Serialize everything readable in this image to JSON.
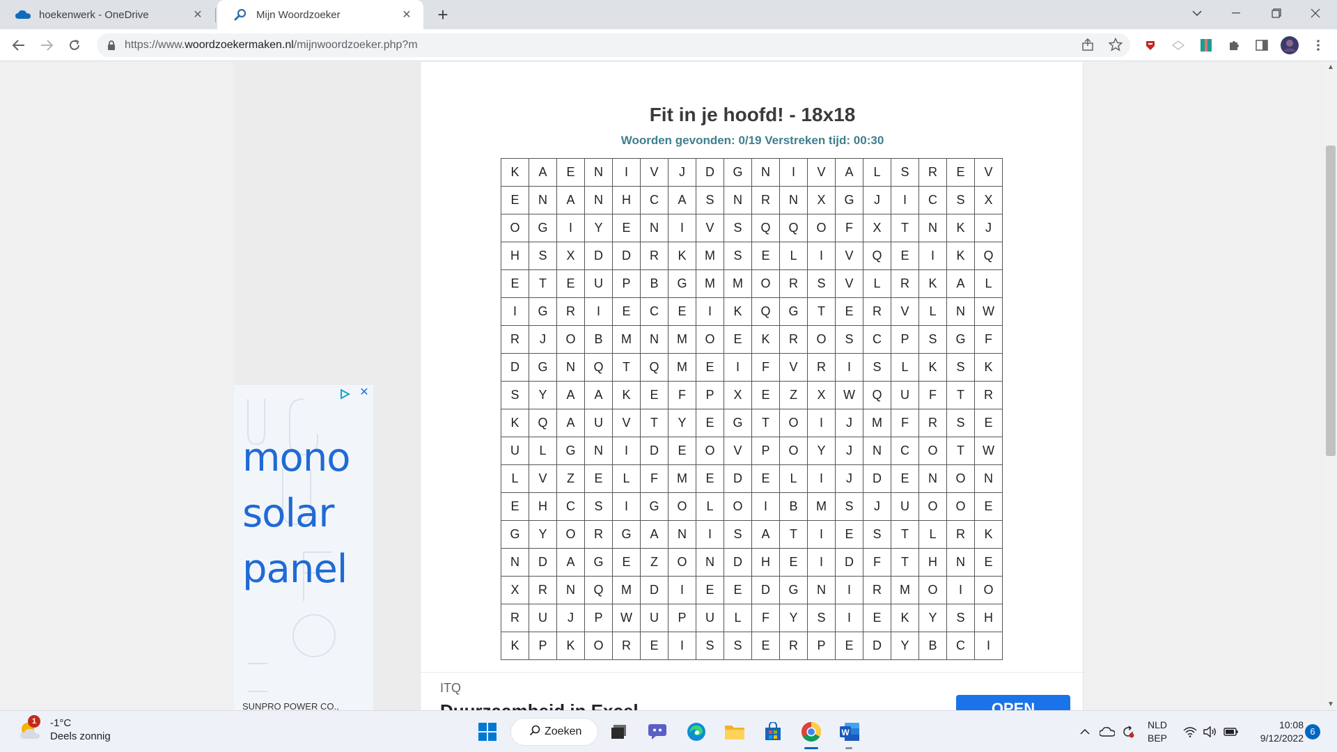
{
  "browser": {
    "tabs": [
      {
        "title": "hoekenwerk - OneDrive",
        "active": false
      },
      {
        "title": "Mijn Woordzoeker",
        "active": true
      }
    ],
    "url_prefix": "https://www.",
    "url_domain": "woordzoekermaken.nl",
    "url_path": "/mijnwoordzoeker.php?m"
  },
  "puzzle": {
    "title": "Fit in je hoofd! - 18x18",
    "status": "Woorden gevonden: 0/19 Verstreken tijd: 00:30",
    "grid": [
      "KAENIVJDGNIVALSREV",
      "ENANHCASNRNXGJICSX",
      "OGIYENIVSQQOFXTNKJ",
      "HSXDDRKMSELIVQEIKQ",
      "ETEUPBGMMORSVLRKAL",
      "IGRIECEIKQGTERVLNW",
      "RJOBMNMOEKROSCPSGF",
      "DGNQTQMEIFVRISLKSK",
      "SYAAKEFPXEZXWQUFTR",
      "KQAUVTYEGTOIJMFRSE",
      "ULGNIDEOVPOYJNCOTW",
      "LVZELFMEDELIJDENON",
      "EHCSIGOLOIBMSJUOOE",
      "GYORGANISATIESTLRK",
      "NDAGEZONDHEIDFTHNE",
      "XRNQMDIEEDGNIRMOIO",
      "RUJPWUPULFYSIEKYSH",
      "KPKOREISSERPEDYBCI"
    ]
  },
  "left_ad": {
    "line1": "mono",
    "line2": "solar",
    "line3": "panel",
    "company": "SUNPRO POWER CO., LTD"
  },
  "bottom_ad": {
    "brand": "ITQ",
    "headline": "Duurzaamheid in Excel",
    "button": "OPEN"
  },
  "taskbar": {
    "weather_badge": "1",
    "temperature": "-1°C",
    "condition": "Deels zonnig",
    "search_label": "Zoeken",
    "lang_line1": "NLD",
    "lang_line2": "BEP",
    "time": "10:08",
    "date": "9/12/2022",
    "notification_count": "6"
  }
}
